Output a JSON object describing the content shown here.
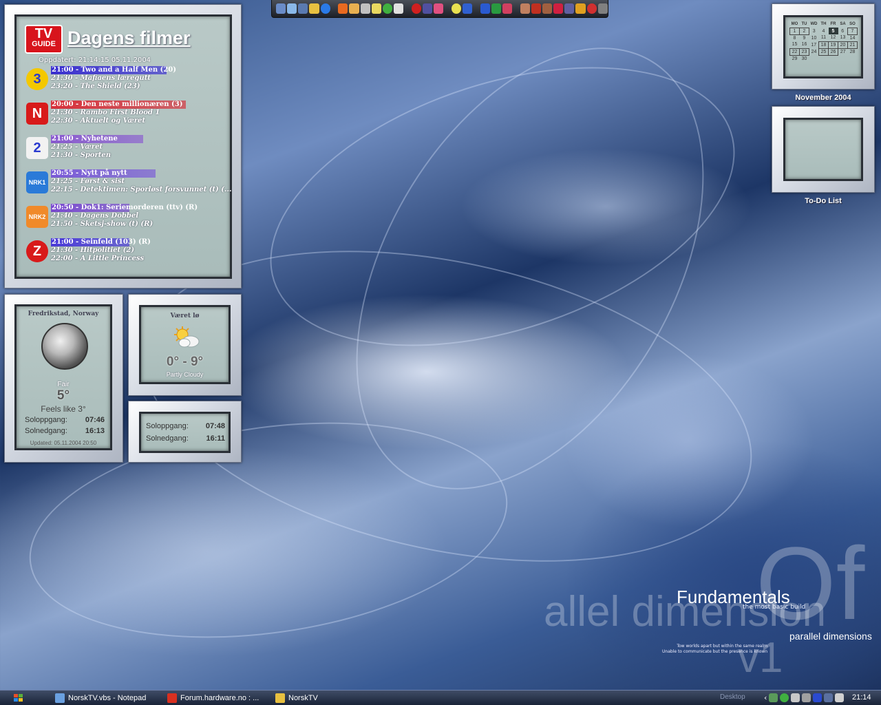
{
  "tvguide": {
    "logo_top": "TV",
    "logo_bottom": "GUIDE",
    "title": "Dagens filmer",
    "updated": "Oppdatert: 21:14:15 05.11.2004",
    "channels": [
      {
        "logo": "3",
        "logo_color": "#f4c800",
        "bar_color": "#3a2fd0",
        "bar_width": 168,
        "now": "21:00 - Two and a Half Men (20)",
        "next1": "21:30 - Mafiaens læregutt",
        "next2": "23:20 - The Shield (23)"
      },
      {
        "logo": "N",
        "logo_color": "#d81a1a",
        "bar_color": "#d8303a",
        "bar_width": 196,
        "now": "20:00 - Den neste millionæren (3)",
        "next1": "21:30 - Rambo First Blood 1",
        "next2": "22:30 - Aktuelt og Været"
      },
      {
        "logo": "2",
        "logo_color": "#f2f2f2",
        "bar_color": "#8a5ad0",
        "bar_width": 134,
        "now": "21:00 - Nyhetene",
        "next1": "21:25 - Været",
        "next2": "21:30 - Sporten"
      },
      {
        "logo": "NRK1",
        "logo_color": "#2a7ad8",
        "bar_color": "#7a5ad8",
        "bar_width": 152,
        "now": "20:55 - Nytt på nytt",
        "next1": "21:25 - Først & sist",
        "next2": "22:15 - Detektimen: Sporløst forsvunnet (t)  (..."
      },
      {
        "logo": "NRK2",
        "logo_color": "#f08a2a",
        "bar_color": "#7a4ad0",
        "bar_width": 114,
        "now": "20:50 - Dok1: Seriemorderen (ttv) (R)",
        "next1": "21:40 - Dagens Dobbel",
        "next2": "21:50 - Sketsj-show (t) (R)"
      },
      {
        "logo": "Z",
        "logo_color": "#d81a1a",
        "bar_color": "#4a3ad8",
        "bar_width": 114,
        "now": "21:00 - Seinfeld (103) (R)",
        "next1": "21:30 - Hitpolitiet (2)",
        "next2": "22:00 - A Little Princess"
      }
    ]
  },
  "weather": {
    "city": "Fredrikstad, Norway",
    "condition": "Fair",
    "temp": "5°",
    "feels": "Feels like 3°",
    "sunrise_label": "Soloppgang:",
    "sunrise": "07:46",
    "sunset_label": "Solnedgang:",
    "sunset": "16:13",
    "updated": "Updated: 05.11.2004 20:50"
  },
  "forecast": {
    "title": "Været lø",
    "range": "0° - 9°",
    "condition": "Partly Cloudy"
  },
  "sun": {
    "sunrise_label": "Soloppgang:",
    "sunrise": "07:48",
    "sunset_label": "Solnedgang:",
    "sunset": "16:11"
  },
  "calendar": {
    "label": "November 2004",
    "weekdays": [
      "MO",
      "TU",
      "WD",
      "TH",
      "FR",
      "SA",
      "SO"
    ],
    "weeks": [
      [
        "1",
        "2",
        "3",
        "4",
        "5",
        "6",
        "7"
      ],
      [
        "8",
        "9",
        "10",
        "11",
        "12",
        "13",
        "14"
      ],
      [
        "15",
        "16",
        "17",
        "18",
        "19",
        "20",
        "21"
      ],
      [
        "22",
        "23",
        "24",
        "25",
        "26",
        "27",
        "28"
      ],
      [
        "29",
        "30",
        "",
        "",
        "",
        "",
        ""
      ]
    ],
    "today": "5"
  },
  "todo": {
    "label": "To-Do List"
  },
  "branding": {
    "big_of": "Of",
    "big_para": "allel dimension",
    "big_v1": "v1",
    "title": "Fundamentals",
    "subtitle": "the most basic build",
    "tagline": "parallel dimensions",
    "quote1": "Tow worlds apart but within the same realm",
    "quote2": "Unable to communicate but the presence is known"
  },
  "taskbar": {
    "tasks": [
      {
        "label": "NorskTV.vbs - Notepad",
        "icon_color": "#6aa0e0"
      },
      {
        "label": "Forum.hardware.no : ...",
        "icon_color": "#d83020"
      },
      {
        "label": "NorskTV",
        "icon_color": "#e8c040"
      }
    ],
    "desktop_label": "Desktop",
    "clock": "21:14"
  }
}
